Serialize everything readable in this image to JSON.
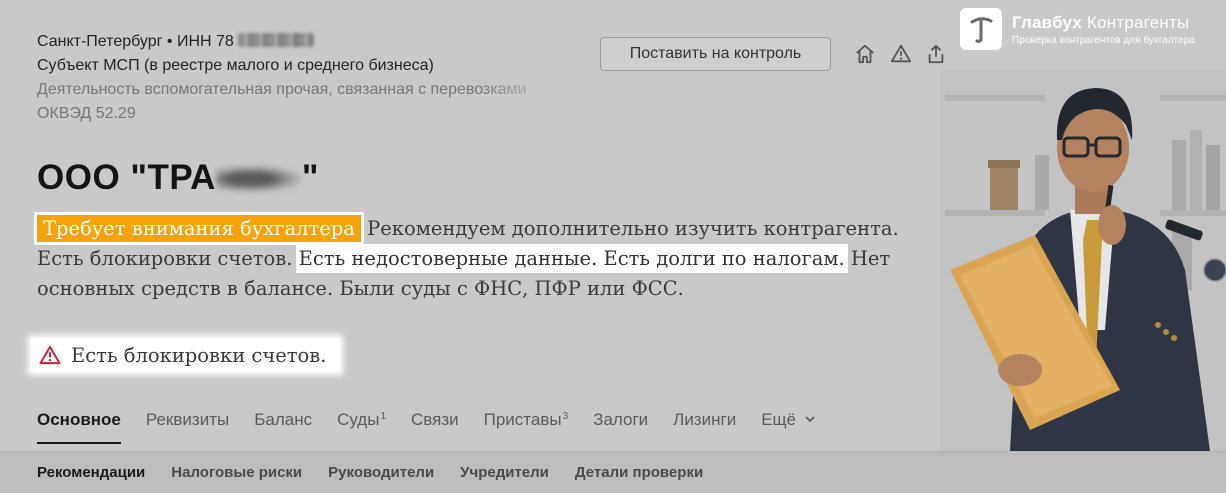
{
  "header": {
    "location_line": "Санкт-Петербург • ИНН 78",
    "sme_line": "Субъект МСП (в реестре малого и среднего бизнеса)",
    "activity_line": "Деятельность вспомогательная прочая, связанная с перевозками",
    "okved_line": "ОКВЭД 52.29",
    "monitor_button": "Поставить на контроль"
  },
  "toolbar_icons": [
    "home-icon",
    "warning-icon",
    "share-icon"
  ],
  "company": {
    "name_prefix": "ООО \"ТРА",
    "name_suffix": "\""
  },
  "summary": {
    "badge": "Требует внимания бухгалтера",
    "text_1": " Рекомендуем дополнительно изучить контрагента. Есть блокировки счетов. ",
    "highlight": "Есть недостоверные данные. Есть долги по налогам.",
    "text_2": " Нет основных средств в балансе. Были суды с ФНС, ПФР или ФСС."
  },
  "alert": {
    "text": "Есть блокировки счетов."
  },
  "tabs": [
    {
      "label": "Основное",
      "sup": ""
    },
    {
      "label": "Реквизиты",
      "sup": ""
    },
    {
      "label": "Баланс",
      "sup": ""
    },
    {
      "label": "Суды",
      "sup": "1"
    },
    {
      "label": "Связи",
      "sup": ""
    },
    {
      "label": "Приставы",
      "sup": "3"
    },
    {
      "label": "Залоги",
      "sup": ""
    },
    {
      "label": "Лизинги",
      "sup": ""
    },
    {
      "label": "Ещё",
      "sup": ""
    }
  ],
  "subtabs": [
    "Рекомендации",
    "Налоговые риски",
    "Руководители",
    "Учредители",
    "Детали проверки"
  ],
  "brand": {
    "title_bold": "Главбух",
    "title_light": " Контрагенты",
    "subtitle": "Проверка контрагентов для бухгалтера"
  },
  "colors": {
    "badge": "#f5a30a",
    "alert_icon": "#d0213a",
    "page_bg": "#c9c9c9"
  }
}
